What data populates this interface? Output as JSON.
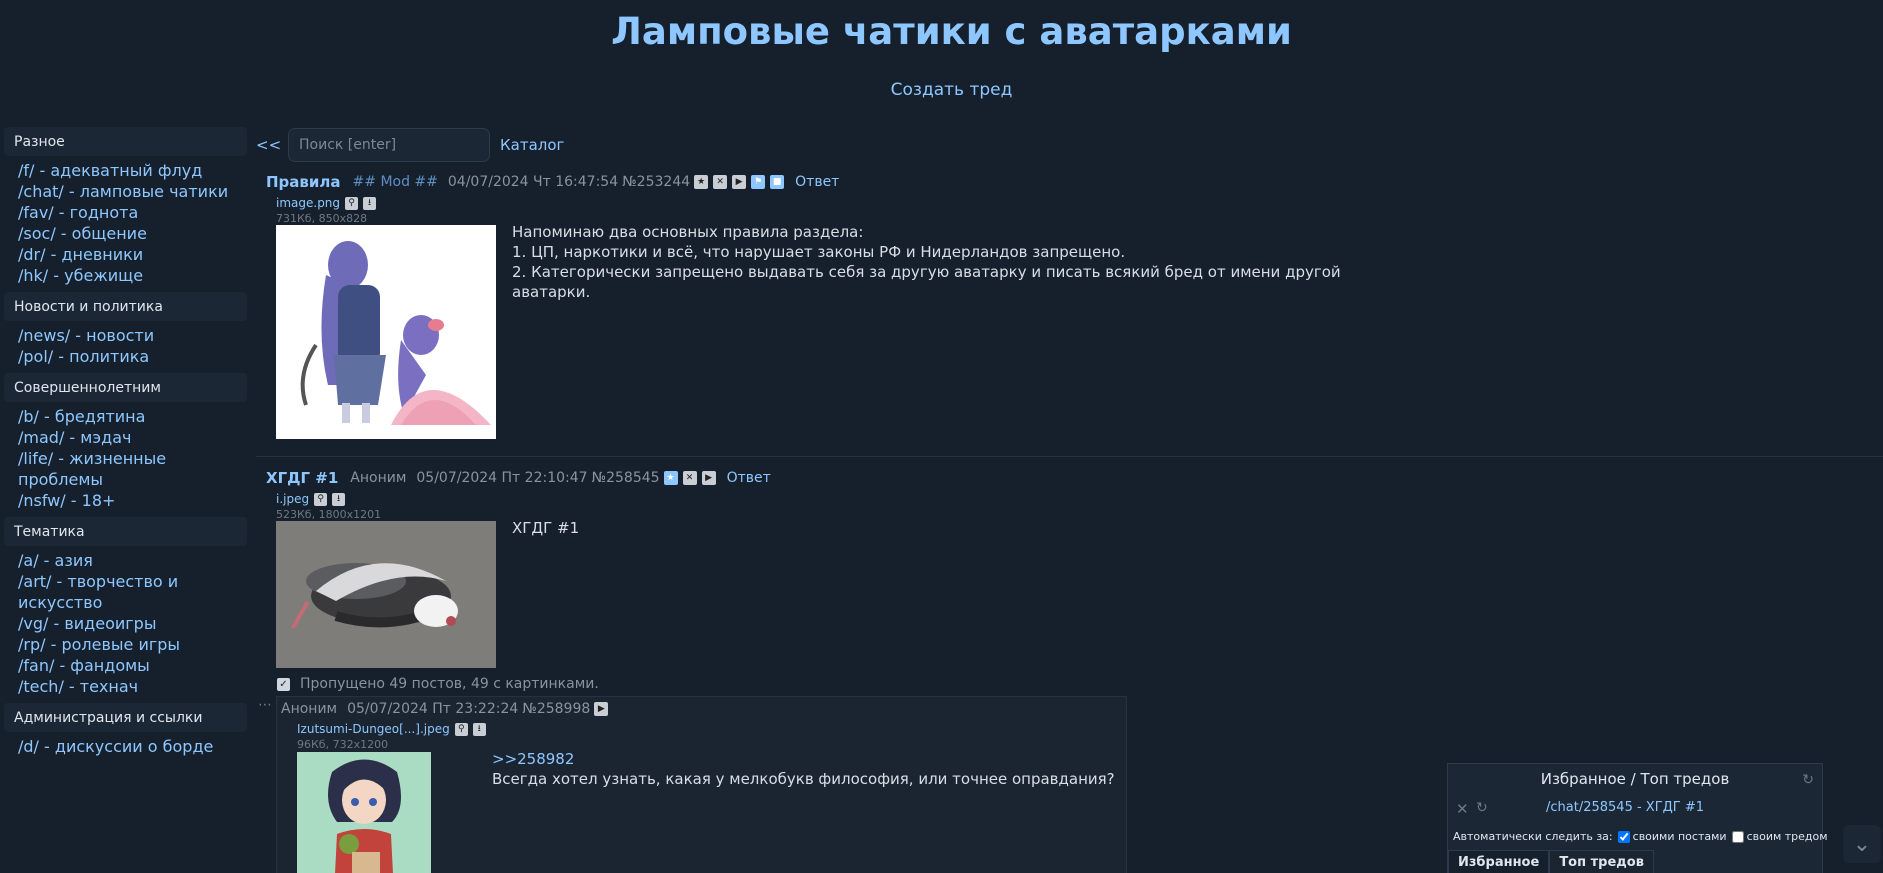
{
  "header": {
    "title": "Ламповые чатики с аватарками",
    "create_thread": "Создать тред"
  },
  "sidebar": {
    "categories": [
      {
        "title": "Разное",
        "boards": [
          "/f/ - адекватный флуд",
          "/chat/ - ламповые чатики",
          "/fav/ - годнота",
          "/soc/ - общение",
          "/dr/ - дневники",
          "/hk/ - убежище"
        ]
      },
      {
        "title": "Новости и политика",
        "boards": [
          "/news/ - новости",
          "/pol/ - политика"
        ]
      },
      {
        "title": "Совершеннолетним",
        "boards": [
          "/b/ - бредятина",
          "/mad/ - мэдач",
          "/life/ - жизненные проблемы",
          "/nsfw/ - 18+"
        ]
      },
      {
        "title": "Тематика",
        "boards": [
          "/a/ - азия",
          "/art/ - творчество и искусство",
          "/vg/ - видеоигры",
          "/rp/ - ролевые игры",
          "/fan/ - фандомы",
          "/tech/ - технач"
        ]
      },
      {
        "title": "Администрация и ссылки",
        "boards": [
          "/d/ - дискуссии о борде"
        ]
      }
    ]
  },
  "toolbar": {
    "back": "<<",
    "search_placeholder": "Поиск [enter]",
    "catalog": "Каталог"
  },
  "posts": [
    {
      "subject": "Правила",
      "name": "## Mod ##",
      "date": "04/07/2024 Чт 16:47:54",
      "number": "№253244",
      "reply": "Ответ",
      "file_name": "image.png",
      "file_meta": "731Кб, 850x828",
      "text": [
        "Напоминаю два основных правила раздела:",
        "1. ЦП, наркотики и всё, что нарушает законы РФ и Нидерландов запрещено.",
        "2. Категорически запрещено выдавать себя за другую аватарку и писать всякий бред от имени другой",
        "аватарки."
      ]
    },
    {
      "subject": "ХГДГ #1",
      "name": "Аноним",
      "date": "05/07/2024 Пт 22:10:47",
      "number": "№258545",
      "reply": "Ответ",
      "file_name": "i.jpeg",
      "file_meta": "523Кб, 1800x1201",
      "text": [
        "ХГДГ #1"
      ]
    }
  ],
  "skipped": "Пропущено 49 постов, 49 с картинками.",
  "reply_post": {
    "name": "Аноним",
    "date": "05/07/2024 Пт 23:22:24",
    "number": "№258998",
    "file_name": "Izutsumi-Dungeo[...].jpeg",
    "file_meta": "96Кб, 732x1200",
    "quote": ">>258982",
    "text": "Всегда хотел узнать, какая у мелкобукв философия, или точнее оправдания?"
  },
  "favorites": {
    "title": "Избранное / Топ тредов",
    "entry": "/chat/258545 - ХГДГ #1",
    "auto_label": "Автоматически следить за:",
    "own_posts": "своими постами",
    "own_thread": "своим тредом",
    "tabs": [
      "Избранное",
      "Топ тредов"
    ]
  }
}
